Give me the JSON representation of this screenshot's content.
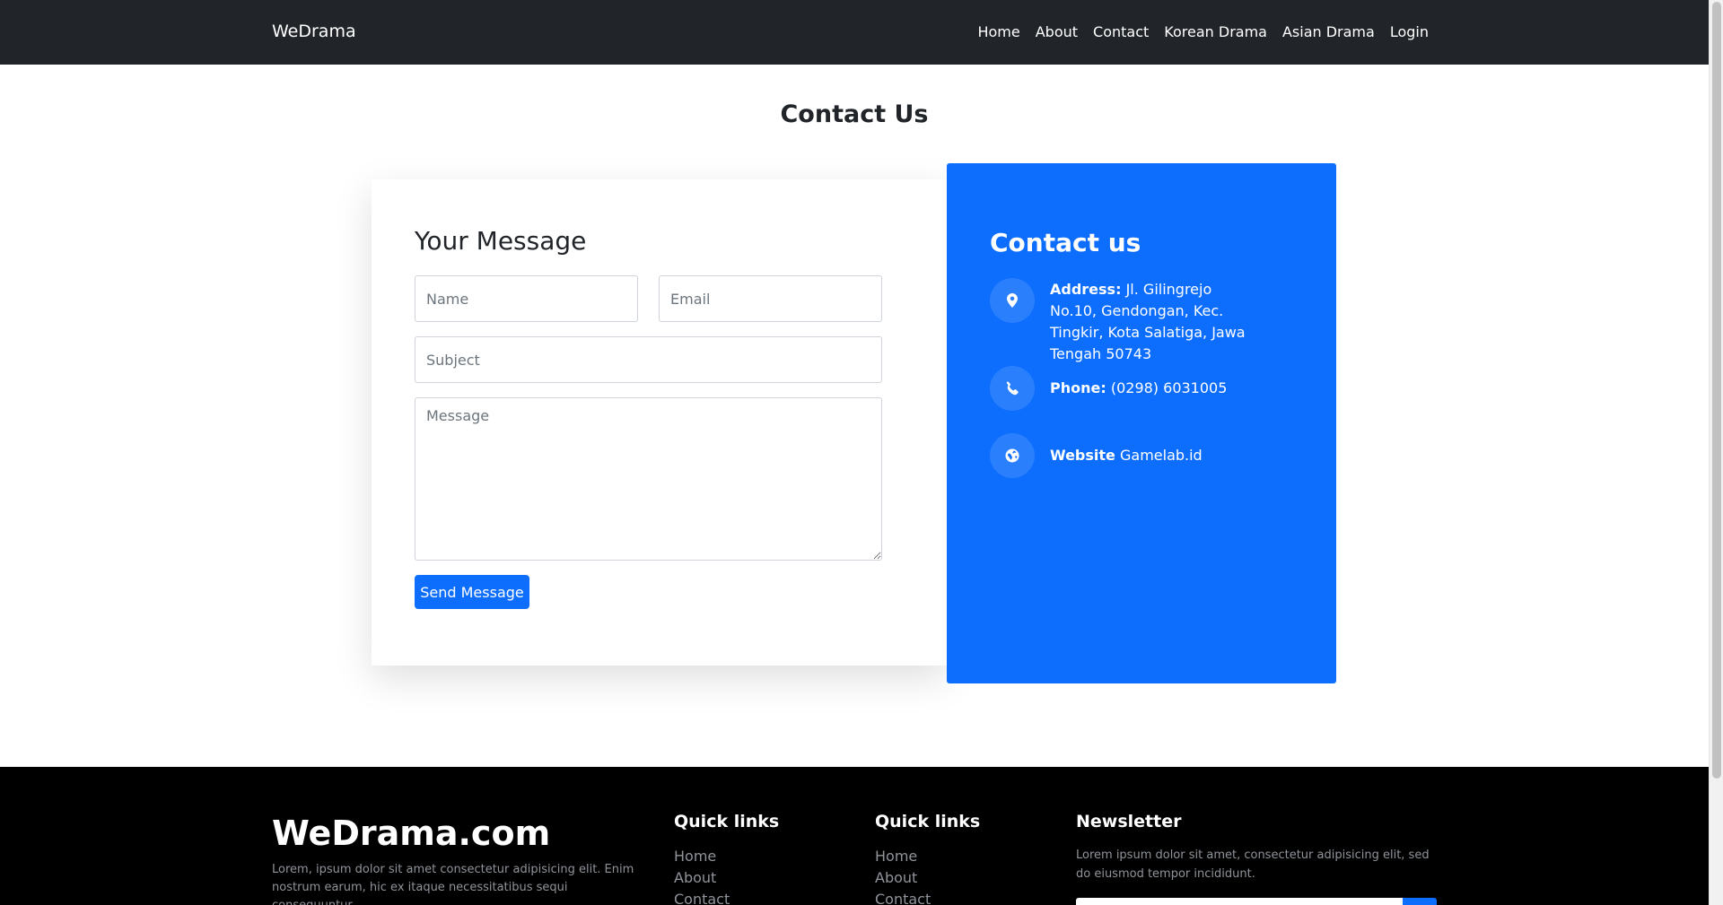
{
  "navbar": {
    "brand": "WeDrama",
    "links": [
      "Home",
      "About",
      "Contact",
      "Korean Drama",
      "Asian Drama",
      "Login"
    ]
  },
  "page": {
    "title": "Contact Us"
  },
  "form": {
    "heading": "Your Message",
    "name_placeholder": "Name",
    "email_placeholder": "Email",
    "subject_placeholder": "Subject",
    "message_placeholder": "Message",
    "submit_label": "Send Message"
  },
  "contact": {
    "heading": "Contact us",
    "address_label": "Address:",
    "address_value": "Jl. Gilingrejo No.10, Gendongan, Kec. Tingkir, Kota Salatiga, Jawa Tengah 50743",
    "phone_label": "Phone:",
    "phone_value": "(0298) 6031005",
    "website_label": "Website",
    "website_value": "Gamelab.id",
    "icons": [
      "map-pin-icon",
      "phone-icon",
      "globe-icon"
    ]
  },
  "footer": {
    "brand": "WeDrama.com",
    "description": "Lorem, ipsum dolor sit amet consectetur adipisicing elit. Enim nostrum earum, hic ex itaque necessitatibus sequi consequuntur",
    "col1_title": "Quick links",
    "col1_links": [
      "Home",
      "About",
      "Contact"
    ],
    "col2_title": "Quick links",
    "col2_links": [
      "Home",
      "About",
      "Contact"
    ],
    "newsletter_title": "Newsletter",
    "newsletter_text": "Lorem ipsum dolor sit amet, consectetur adipisicing elit, sed do eiusmod tempor incididunt."
  },
  "colors": {
    "navbar_bg": "#212529",
    "accent": "#0d6efd",
    "footer_bg": "#000000"
  }
}
